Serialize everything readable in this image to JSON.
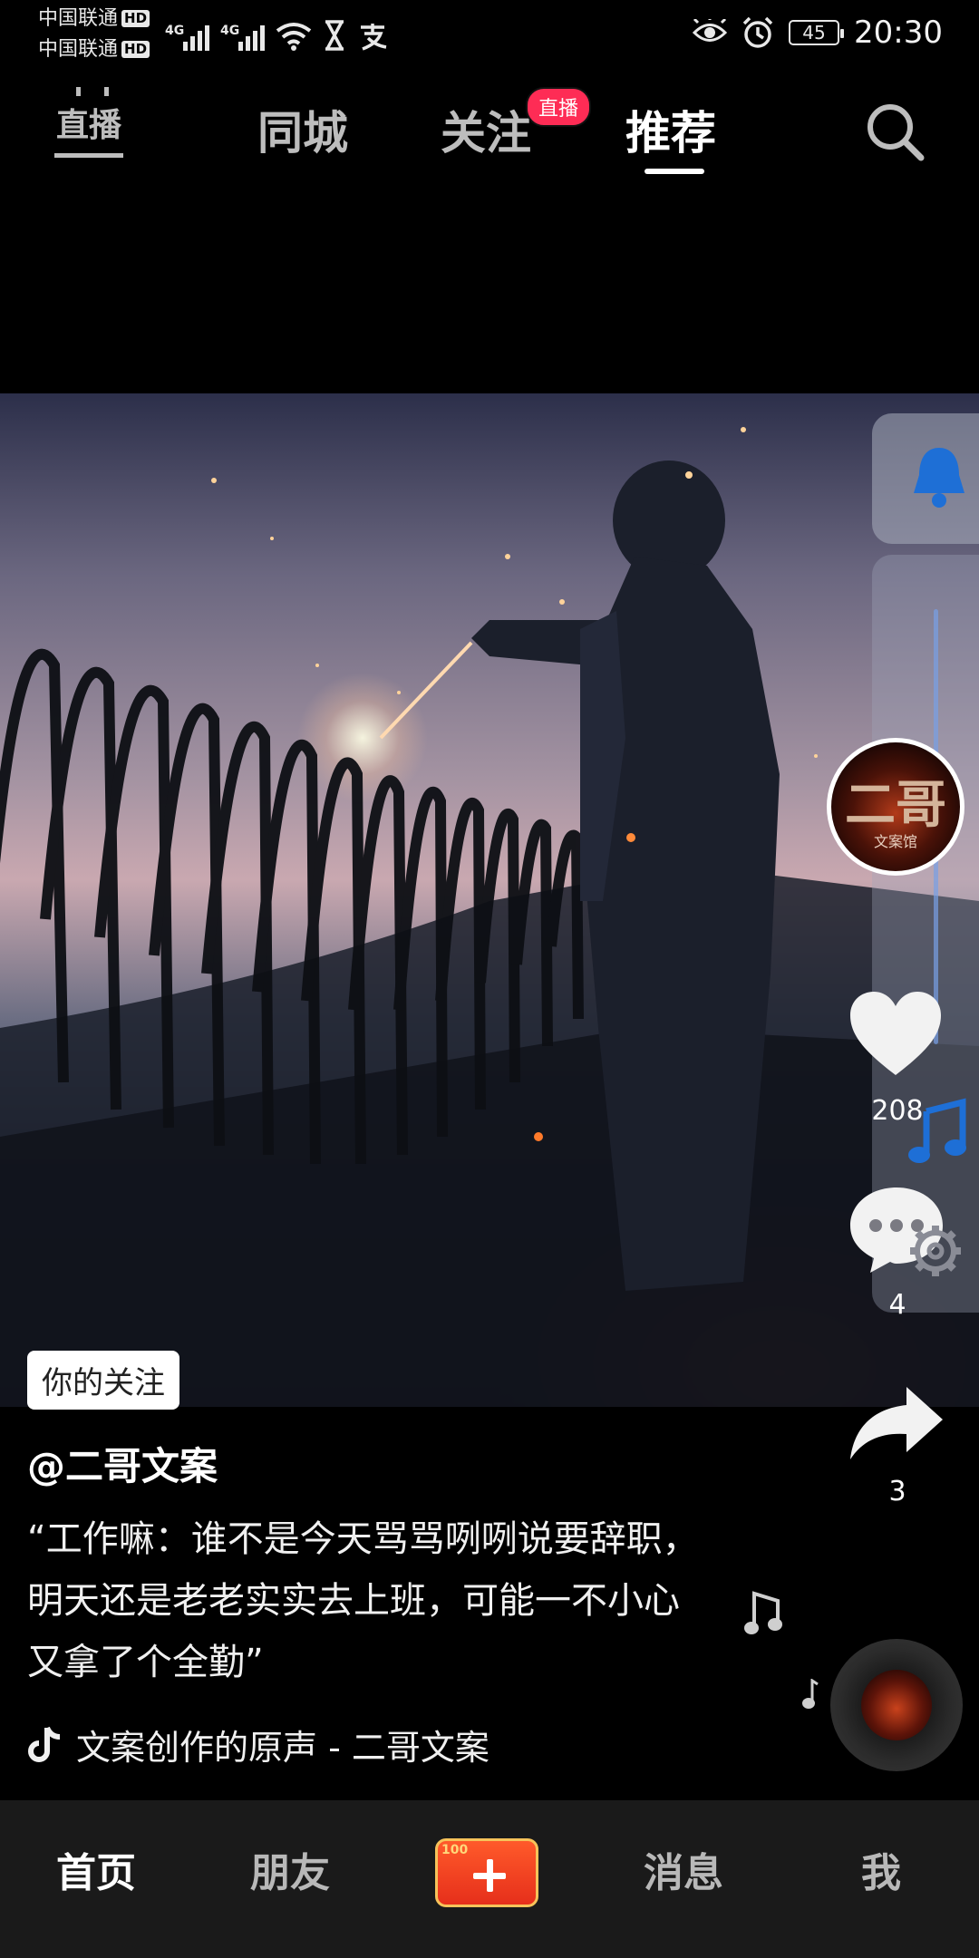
{
  "status_bar": {
    "carrier1": "中国联通",
    "carrier2": "中国联通",
    "hd_label": "HD",
    "net1": "4G",
    "net2": "4G",
    "battery": "45",
    "time": "20:30",
    "icons": [
      "signal-icon",
      "wifi-icon",
      "hourglass-icon",
      "alipay-icon",
      "eye-icon",
      "alarm-icon",
      "battery-icon"
    ]
  },
  "top_nav": {
    "live_entry": "直播",
    "tabs": [
      {
        "label": "同城",
        "active": false
      },
      {
        "label": "关注",
        "active": false
      },
      {
        "label": "推荐",
        "active": true
      }
    ],
    "live_badge": "直播",
    "search_icon": "search-icon"
  },
  "video": {
    "follow_tag": "你的关注"
  },
  "right_rail": {
    "avatar_text": "二哥",
    "avatar_sub": "文案馆",
    "like_count": "208",
    "comment_count": "4",
    "share_count": "3",
    "icons": [
      "bell-icon",
      "heart-icon",
      "comment-icon",
      "share-icon",
      "music-note-icon",
      "gear-icon",
      "music-disc-icon"
    ]
  },
  "caption": {
    "author": "@二哥文案",
    "description": "“工作嘛：谁不是今天骂骂咧咧说要辞职，明天还是老老实实去上班，可能一不小心又拿了个全勤”",
    "music": "文案创作的原声 - 二哥文案"
  },
  "bottom_nav": {
    "items": [
      {
        "label": "首页",
        "active": true
      },
      {
        "label": "朋友",
        "active": false
      },
      {
        "label": "消息",
        "active": false
      },
      {
        "label": "我",
        "active": false
      }
    ],
    "create_icon": "plus-icon",
    "create_tag": "100"
  },
  "colors": {
    "accent": "#fe2c55",
    "background": "#000000",
    "bottom_nav_bg": "#1a1a1a"
  }
}
